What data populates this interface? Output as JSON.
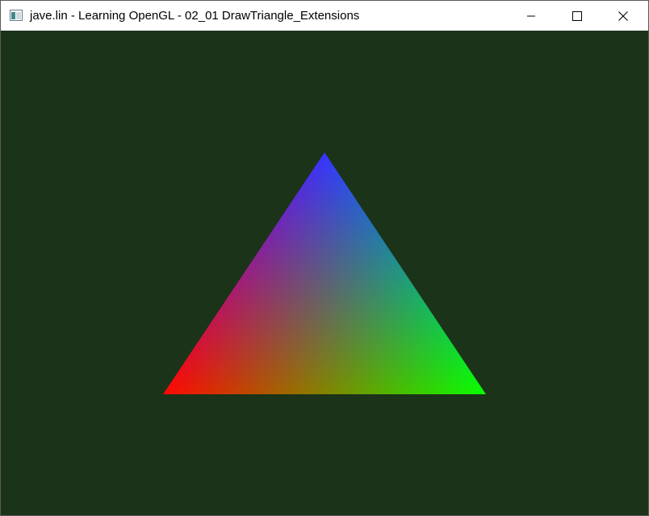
{
  "window": {
    "title": "jave.lin - Learning OpenGL - 02_01 DrawTriangle_Extensions",
    "controls": [
      {
        "name": "minimize",
        "icon": "minimize-icon"
      },
      {
        "name": "maximize",
        "icon": "maximize-icon"
      },
      {
        "name": "close",
        "icon": "close-icon"
      }
    ]
  },
  "scene": {
    "clear_color": "#1b3319",
    "triangle": {
      "vertex_colors": {
        "top": "#0000ff",
        "bottom_left": "#ff0000",
        "bottom_right": "#00ff00"
      }
    }
  }
}
